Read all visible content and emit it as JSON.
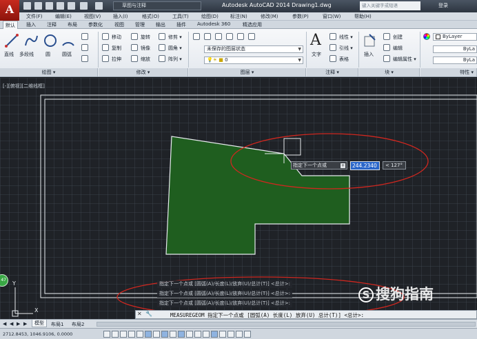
{
  "app": {
    "logo_letter": "A",
    "workspace": "草图与注释",
    "title": "Autodesk AutoCAD 2014    Drawing1.dwg",
    "search_placeholder": "键入关键字或短语",
    "login": "登录"
  },
  "menu": [
    "文件(F)",
    "编辑(E)",
    "视图(V)",
    "插入(I)",
    "格式(O)",
    "工具(T)",
    "绘图(D)",
    "标注(N)",
    "修改(M)",
    "参数(P)",
    "窗口(W)",
    "帮助(H)"
  ],
  "ribbon_tabs": [
    "默认",
    "插入",
    "注释",
    "布局",
    "参数化",
    "视图",
    "管理",
    "输出",
    "插件",
    "Autodesk 360",
    "精选应用"
  ],
  "ribbon": {
    "draw": {
      "title": "绘图 ▾",
      "line": "直线",
      "polyline": "多段线",
      "circle": "圆",
      "arc": "圆弧"
    },
    "modify": {
      "title": "修改 ▾",
      "move": "移动",
      "rotate": "旋转",
      "trim": "修剪 ▾",
      "copy": "复制",
      "mirror": "镜像",
      "fillet": "圆角 ▾",
      "stretch": "拉伸",
      "scale": "缩放",
      "array": "阵列 ▾"
    },
    "layers": {
      "title": "图层 ▾",
      "state": "未保存的图层状态",
      "current": "0"
    },
    "annotation": {
      "title": "注释 ▾",
      "text": "文字",
      "linear": "线性 ▾",
      "leader": "引线 ▾",
      "table": "表格"
    },
    "block": {
      "title": "块 ▾",
      "insert": "插入",
      "create": "创建",
      "edit": "编辑",
      "edit_attr": "编辑属性 ▾"
    },
    "properties": {
      "title": "特性 ▾",
      "color": "ByLayer",
      "linetype": "ByLa",
      "lineweight": "ByLa"
    }
  },
  "drawing": {
    "viewport_label": "[-][俯视][二维线框]",
    "tooltip_prompt": "指定下一个点或",
    "tooltip_plus": "+",
    "dynamic_distance": "244.2340",
    "dynamic_angle": "< 127°",
    "history": [
      "指定下一个点或 [圆弧(A)/长度(L)/放弃(U)/总计(T)] <总计>:",
      "指定下一个点或 [圆弧(A)/长度(L)/放弃(U)/总计(T)] <总计>:",
      "指定下一个点或 [圆弧(A)/长度(L)/放弃(U)/总计(T)] <总计>:"
    ],
    "command_line": "MEASUREGEOM 指定下一个点或 [圆弧(A) 长度(L) 放弃(U) 总计(T)] <总计>:",
    "ucs_x": "X",
    "ucs_y": "Y",
    "badge": "47",
    "watermark": "搜狗指南",
    "watermark_logo": "S"
  },
  "layout_tabs": [
    "模型",
    "布局1",
    "布局2"
  ],
  "status": {
    "coords": "2712.8453, 1046.9106, 0.0000"
  },
  "colors": {
    "region_fill": "#1f5e1f",
    "ellipse": "#d0271f",
    "accent_input": "#2a66c9"
  }
}
